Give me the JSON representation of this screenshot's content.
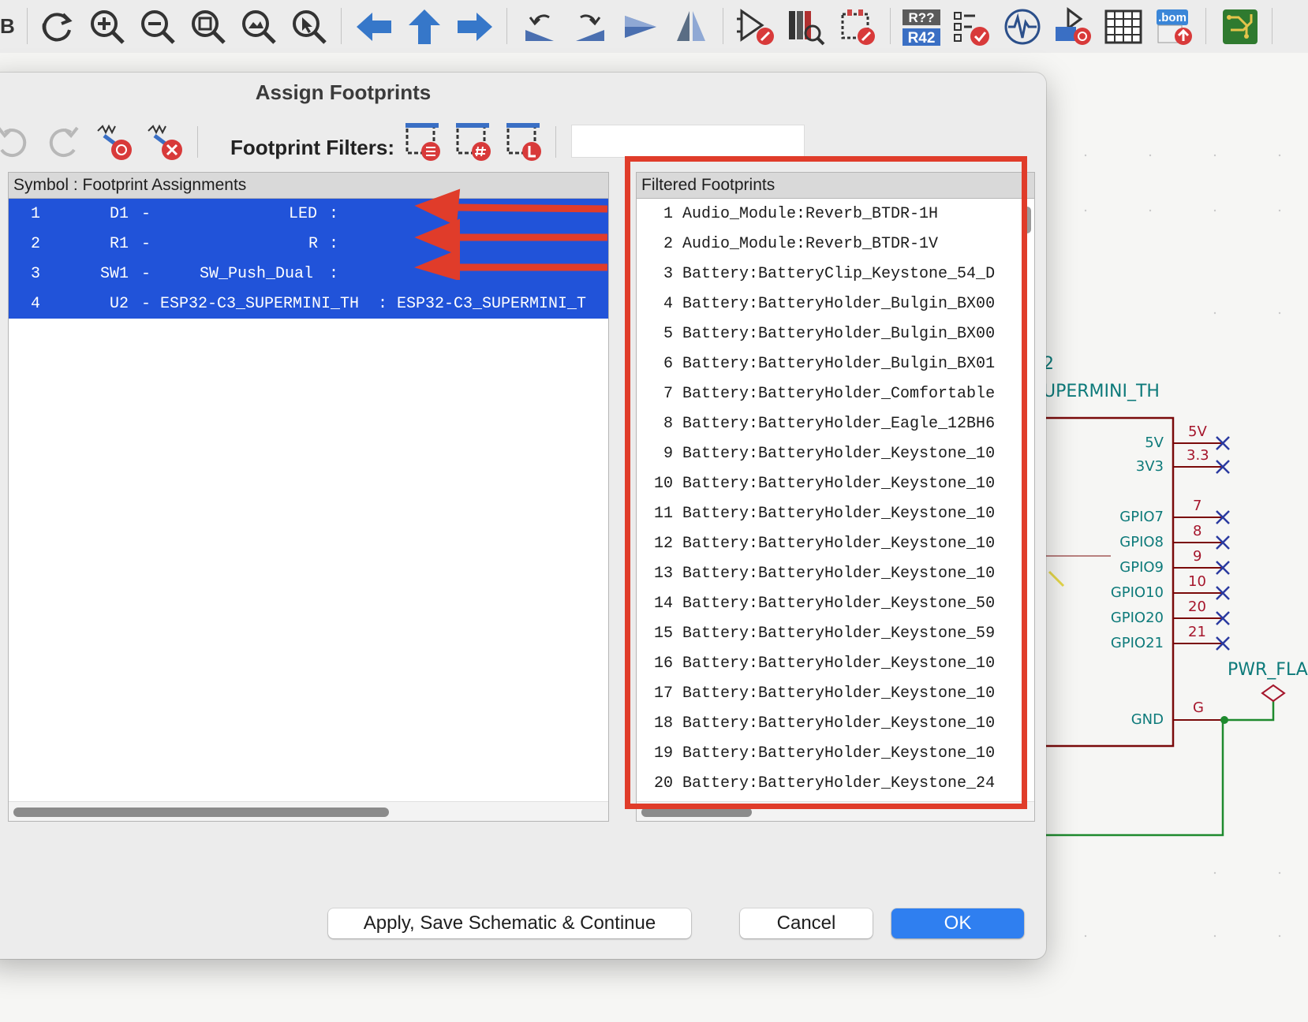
{
  "toolbar": {
    "edge_glyph": "B",
    "tools": [
      {
        "icon": "refresh-icon"
      },
      {
        "icon": "zoom-in-icon"
      },
      {
        "icon": "zoom-out-icon"
      },
      {
        "icon": "zoom-fit-icon"
      },
      {
        "icon": "zoom-objects-icon"
      },
      {
        "icon": "zoom-selection-icon"
      },
      {
        "icon": "arrow-left-icon"
      },
      {
        "icon": "arrow-up-icon"
      },
      {
        "icon": "arrow-right-icon"
      },
      {
        "icon": "rotate-ccw-icon"
      },
      {
        "icon": "rotate-cw-icon"
      },
      {
        "icon": "mirror-horizontal-icon"
      },
      {
        "icon": "mirror-vertical-icon"
      },
      {
        "icon": "symbol-editor-icon"
      },
      {
        "icon": "library-browser-icon"
      },
      {
        "icon": "footprint-editor-icon"
      },
      {
        "icon": "annotate-icon",
        "label_top": "R??",
        "label_bottom": "R42"
      },
      {
        "icon": "erc-icon"
      },
      {
        "icon": "simulator-icon"
      },
      {
        "icon": "assign-footprints-icon"
      },
      {
        "icon": "fields-table-icon"
      },
      {
        "icon": "bom-icon",
        "label": ".bom"
      },
      {
        "icon": "pcb-editor-icon"
      }
    ]
  },
  "schematic": {
    "ref_fragment": "2",
    "value_fragment": "UPERMINI_TH",
    "pins": [
      {
        "name": "5V",
        "number": "5V"
      },
      {
        "name": "3V3",
        "number": "3.3"
      },
      {
        "name": "GPIO7",
        "number": "7"
      },
      {
        "name": "GPIO8",
        "number": "8"
      },
      {
        "name": "GPIO9",
        "number": "9"
      },
      {
        "name": "GPIO10",
        "number": "10"
      },
      {
        "name": "GPIO20",
        "number": "20"
      },
      {
        "name": "GPIO21",
        "number": "21"
      },
      {
        "name": "GND",
        "number": "G"
      }
    ],
    "pwr_flag_label": "PWR_FLA",
    "colors": {
      "wire": "#1e8a2e",
      "body": "#7a0a0a",
      "text": "#0d7a7a",
      "pin": "#a5162c",
      "no_connect": "#2a3aa0"
    }
  },
  "dialog": {
    "title": "Assign Footprints",
    "toolbar_icons": [
      "undo-icon",
      "redo-icon",
      "associate-footprint-icon",
      "delete-association-icon",
      "filter-by-keywords-icon",
      "filter-by-pin-count-icon",
      "filter-by-library-icon"
    ],
    "filters_label": "Footprint Filters:",
    "filter_text": "",
    "left_panel": {
      "header": "Symbol : Footprint Assignments",
      "rows": [
        {
          "index": "1",
          "ref": "D1",
          "value": "LED",
          "footprint": ""
        },
        {
          "index": "2",
          "ref": "R1",
          "value": "R",
          "footprint": ""
        },
        {
          "index": "3",
          "ref": "SW1",
          "value": "SW_Push_Dual",
          "footprint": ""
        },
        {
          "index": "4",
          "ref": "U2",
          "value": "ESP32-C3_SUPERMINI_TH",
          "footprint": "ESP32-C3_SUPERMINI_T"
        }
      ],
      "dash": "-",
      "colon": ":",
      "selection_color": "#2153d9"
    },
    "right_panel": {
      "header": "Filtered Footprints",
      "rows": [
        {
          "index": "1",
          "name": "Audio_Module:Reverb_BTDR-1H"
        },
        {
          "index": "2",
          "name": "Audio_Module:Reverb_BTDR-1V"
        },
        {
          "index": "3",
          "name": "Battery:BatteryClip_Keystone_54_D"
        },
        {
          "index": "4",
          "name": "Battery:BatteryHolder_Bulgin_BX00"
        },
        {
          "index": "5",
          "name": "Battery:BatteryHolder_Bulgin_BX00"
        },
        {
          "index": "6",
          "name": "Battery:BatteryHolder_Bulgin_BX01"
        },
        {
          "index": "7",
          "name": "Battery:BatteryHolder_Comfortable"
        },
        {
          "index": "8",
          "name": "Battery:BatteryHolder_Eagle_12BH6"
        },
        {
          "index": "9",
          "name": "Battery:BatteryHolder_Keystone_10"
        },
        {
          "index": "10",
          "name": "Battery:BatteryHolder_Keystone_10"
        },
        {
          "index": "11",
          "name": "Battery:BatteryHolder_Keystone_10"
        },
        {
          "index": "12",
          "name": "Battery:BatteryHolder_Keystone_10"
        },
        {
          "index": "13",
          "name": "Battery:BatteryHolder_Keystone_10"
        },
        {
          "index": "14",
          "name": "Battery:BatteryHolder_Keystone_50"
        },
        {
          "index": "15",
          "name": "Battery:BatteryHolder_Keystone_59"
        },
        {
          "index": "16",
          "name": "Battery:BatteryHolder_Keystone_10"
        },
        {
          "index": "17",
          "name": "Battery:BatteryHolder_Keystone_10"
        },
        {
          "index": "18",
          "name": "Battery:BatteryHolder_Keystone_10"
        },
        {
          "index": "19",
          "name": "Battery:BatteryHolder_Keystone_10"
        },
        {
          "index": "20",
          "name": "Battery:BatteryHolder_Keystone_24"
        }
      ]
    },
    "buttons": {
      "apply": "Apply, Save Schematic & Continue",
      "cancel": "Cancel",
      "ok": "OK"
    },
    "annotation_color": "#e03c2a"
  }
}
